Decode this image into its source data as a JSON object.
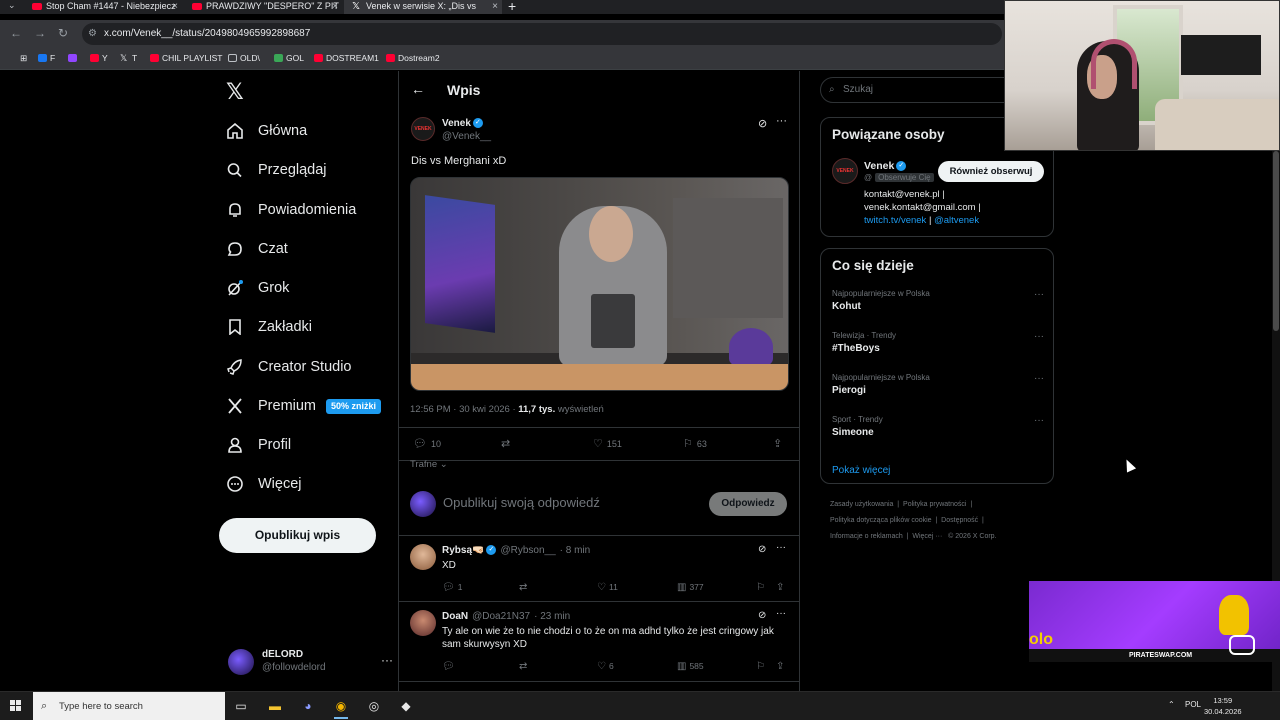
{
  "browser": {
    "tabs": [
      {
        "title": "Stop Cham #1447 - Niebezpiecz",
        "icon": "youtube-icon",
        "active": false
      },
      {
        "title": "PRAWDZIWY \"DESPERO\" Z PIT",
        "icon": "youtube-icon",
        "active": false
      },
      {
        "title": "Venek w serwisie X: „Dis vs",
        "icon": "x-icon",
        "active": true
      }
    ],
    "url": "x.com/Venek__/status/2049804965992898687",
    "bookmarks": [
      {
        "label": "F",
        "color": "#1877f2"
      },
      {
        "label": "",
        "color": "#9146ff"
      },
      {
        "label": "Y",
        "color": "#ff0033"
      },
      {
        "label": "T",
        "color": "#000000"
      },
      {
        "label": "CHIL PLAYLIST",
        "color": "#ff0033"
      },
      {
        "label": "OLD\\",
        "color": "#8a8a8a"
      },
      {
        "label": "GOL",
        "color": "#3aa757"
      },
      {
        "label": "DOSTREAM1",
        "color": "#ff0033"
      },
      {
        "label": "Dostream2",
        "color": "#ff0033"
      }
    ]
  },
  "nav": {
    "items": [
      {
        "label": "Główna",
        "icon": "home-icon"
      },
      {
        "label": "Przeglądaj",
        "icon": "search-icon"
      },
      {
        "label": "Powiadomienia",
        "icon": "bell-icon"
      },
      {
        "label": "Czat",
        "icon": "chat-icon"
      },
      {
        "label": "Grok",
        "icon": "grok-icon"
      },
      {
        "label": "Zakładki",
        "icon": "bookmark-icon"
      },
      {
        "label": "Creator Studio",
        "icon": "rocket-icon"
      },
      {
        "label": "Premium",
        "icon": "x-premium-icon"
      },
      {
        "label": "Profil",
        "icon": "user-icon"
      },
      {
        "label": "Więcej",
        "icon": "more-circle-icon"
      }
    ],
    "premium_badge": "50% zniżki",
    "post_button": "Opublikuj wpis",
    "account": {
      "name": "dELORD",
      "handle": "@followdelord"
    }
  },
  "post": {
    "header": "Wpis",
    "author": "Venek",
    "handle": "@Venek__",
    "avatar_text": "VENEK",
    "text": "Dis vs Merghani xD",
    "time": "12:56 PM · 30 kwi 2026 · ",
    "views_count": "11,7 tys.",
    "views_label": " wyświetleń",
    "actions": {
      "replies": "10",
      "reposts": "",
      "likes": "151",
      "bookmarks": "63"
    },
    "sort_label": "Trafne",
    "reply_placeholder": "Opublikuj swoją odpowiedź",
    "reply_button": "Odpowiedz"
  },
  "comments": [
    {
      "name": "Rybsą",
      "emoji": "🤜🏻",
      "verified": true,
      "handle": "@Rybson__",
      "time": "· 8 min",
      "text": "XD",
      "replies": "1",
      "reposts": "",
      "likes": "11",
      "views": "377"
    },
    {
      "name": "DoaN",
      "emoji": "",
      "verified": false,
      "handle": "@Doa21N37",
      "time": "· 23 min",
      "text": "Ty ale on wie że to nie chodzi o to że on ma adhd tylko że jest cringowy jak sam skurwysyn XD",
      "replies": "",
      "reposts": "",
      "likes": "6",
      "views": "585"
    }
  ],
  "sidebar": {
    "search_placeholder": "Szukaj",
    "related": {
      "title": "Powiązane osoby",
      "name": "Venek",
      "handle": "@",
      "follows_you": "Obserwuje Cię",
      "follow_button": "Również obserwuj",
      "bio_line1": "kontakt@venek.pl |",
      "bio_line2": "venek.kontakt@gmail.com |",
      "bio_link1": "twitch.tv/venek",
      "bio_sep": " | ",
      "bio_link2": "@altvenek"
    },
    "trending": {
      "title": "Co się dzieje",
      "items": [
        {
          "context": "Najpopularniejsze w Polska",
          "name": "Kohut"
        },
        {
          "context": "Telewizja · Trendy",
          "name": "#TheBoys"
        },
        {
          "context": "Najpopularniejsze w Polska",
          "name": "Pierogi"
        },
        {
          "context": "Sport · Trendy",
          "name": "Simeone"
        }
      ],
      "show_more": "Pokaż więcej"
    },
    "footer_links": [
      "Zasady użytkowania",
      "Polityka prywatności",
      "Polityka dotycząca plików cookie",
      "Dostępność",
      "Informacje o reklamach",
      "Więcej ···",
      "© 2026 X Corp."
    ]
  },
  "ad": {
    "brand": "PIRATESWAP.COM",
    "logo_text": "olo"
  },
  "taskbar": {
    "search_placeholder": "Type here to search",
    "language": "POL",
    "time": "13:59",
    "date": "30.04.2026"
  }
}
